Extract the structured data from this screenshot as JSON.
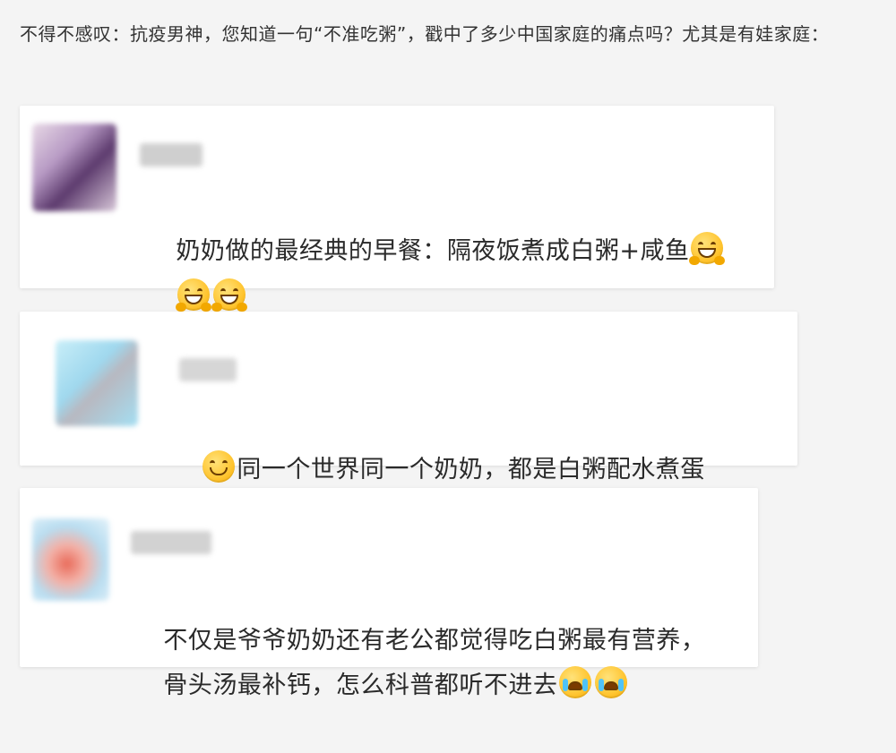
{
  "intro": {
    "text": "不得不感叹：抗疫男神，您知道一句“不准吃粥”，戳中了多少中国家庭的痛点吗？尤其是有娃家庭："
  },
  "comments": [
    {
      "text_line1": "奶奶做的最经典的早餐：隔夜饭煮成白粥+咸鱼",
      "emoji_after_line1": "grinning-hands-emoji",
      "emoji_line2": [
        "grinning-hands-emoji",
        "grinning-hands-emoji"
      ]
    },
    {
      "leading_emoji": "smile-emoji",
      "text": "同一个世界同一个奶奶，都是白粥配水煮蛋"
    },
    {
      "text_line1": "不仅是爷爷奶奶还有老公都觉得吃白粥最有营养，",
      "text_line2": "骨头汤最补钙，怎么科普都听不进去",
      "trailing_emojis": [
        "crying-emoji",
        "crying-emoji"
      ]
    }
  ],
  "colors": {
    "background": "#f4f4f4",
    "card": "#ffffff",
    "text": "#2a2a2a",
    "emoji_yellow": "#ffc531"
  }
}
